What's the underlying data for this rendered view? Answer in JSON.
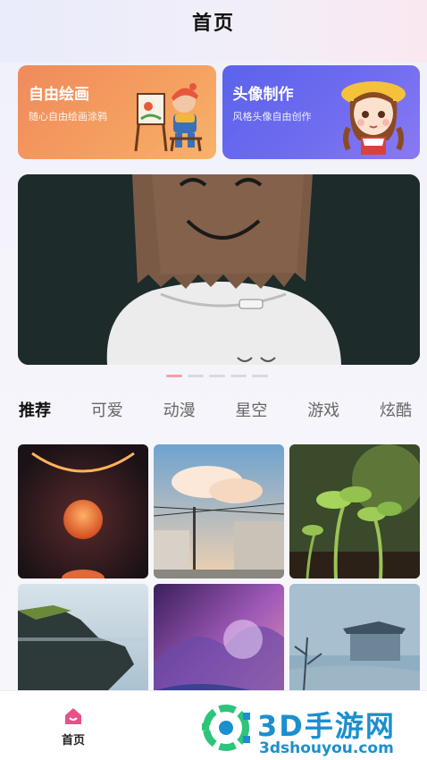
{
  "header": {
    "title": "首页"
  },
  "feature_cards": [
    {
      "title": "自由绘画",
      "subtitle": "随心自由绘画涂鸦",
      "color": "#f08a5c"
    },
    {
      "title": "头像制作",
      "subtitle": "风格头像自由创作",
      "color": "#5b63ea"
    }
  ],
  "banner": {
    "active_index": 0,
    "count": 5
  },
  "categories": {
    "items": [
      "推荐",
      "可爱",
      "动漫",
      "星空",
      "游戏",
      "炫酷"
    ],
    "active": "推荐"
  },
  "tabbar": {
    "home_label": "首页",
    "accent": "#e8508a"
  },
  "watermark": {
    "title": "3D手游网",
    "url": "3dshouyou.com"
  }
}
